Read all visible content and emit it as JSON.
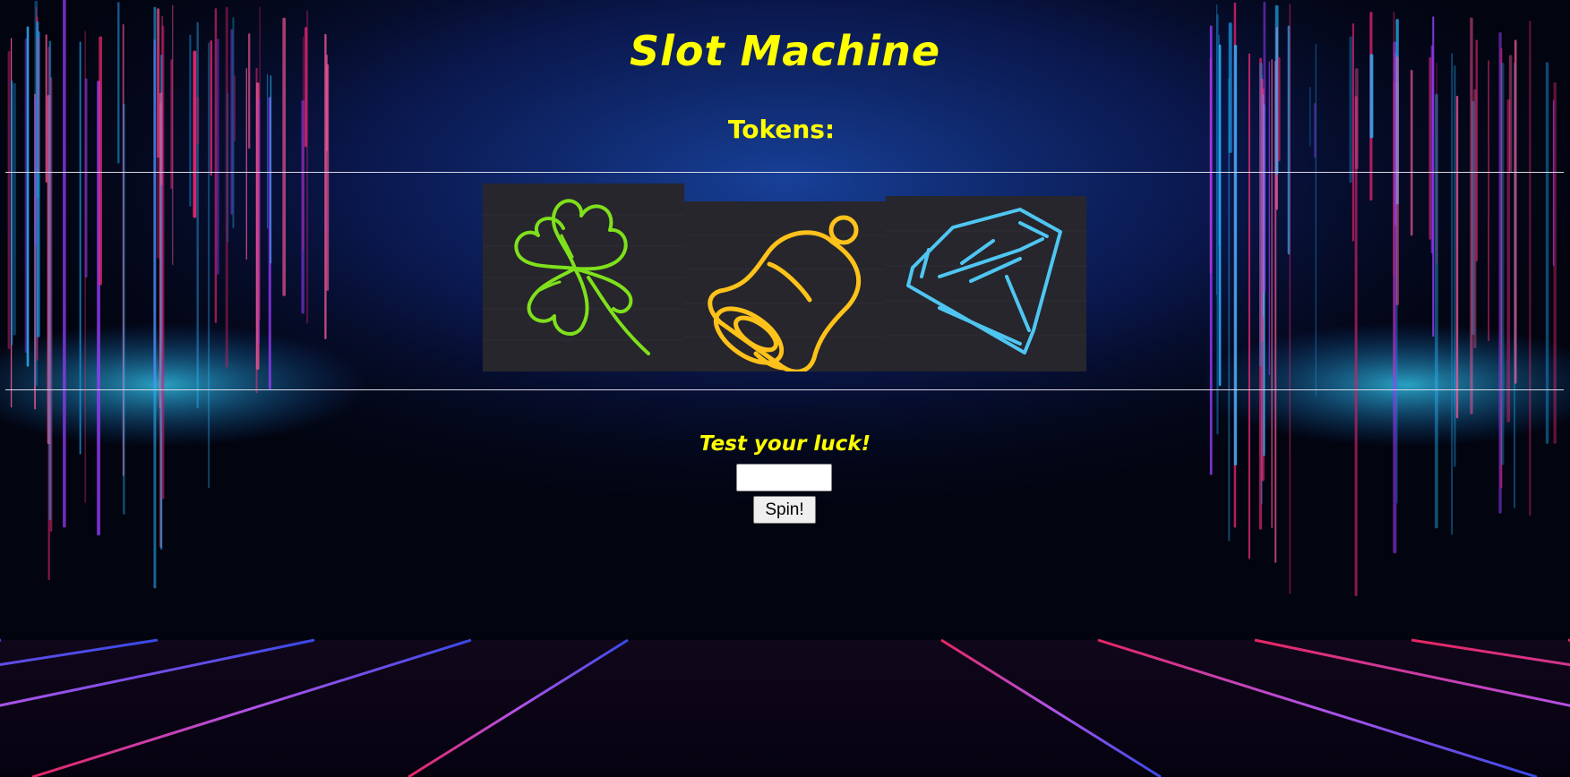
{
  "page": {
    "title": "Slot Machine",
    "tokens_label": "Tokens:",
    "tokens_value": "",
    "prompt": "Test your luck!"
  },
  "bet": {
    "value": "",
    "placeholder": ""
  },
  "spin_button": {
    "label": "Spin!"
  },
  "reels": [
    {
      "symbol": "clover-icon",
      "color": "#7fe01c"
    },
    {
      "symbol": "bell-icon",
      "color": "#ffc21a"
    },
    {
      "symbol": "diamond-icon",
      "color": "#4fc6f2"
    }
  ],
  "colors": {
    "heading": "#ffff00",
    "background": "#02040f",
    "reel_background": "#26262c"
  }
}
